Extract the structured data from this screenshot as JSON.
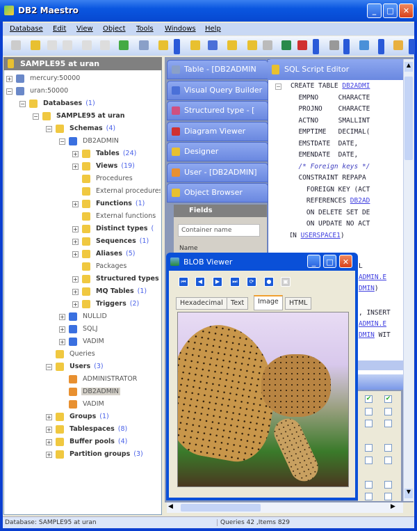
{
  "window": {
    "title": "DB2 Maestro",
    "min": "_",
    "max": "□",
    "close": "✕"
  },
  "menu": [
    "Database",
    "Edit",
    "View",
    "Object",
    "Tools",
    "Windows",
    "Help"
  ],
  "left_panel": {
    "title": "SAMPLE95 at uran"
  },
  "tree": [
    {
      "label": "mercury:50000",
      "count": "",
      "level": 0,
      "exp": "+",
      "style": "norm",
      "icon": "server-icon"
    },
    {
      "label": "uran:50000",
      "count": "",
      "level": 0,
      "exp": "−",
      "style": "norm",
      "icon": "server-icon"
    },
    {
      "label": "Databases",
      "count": "(1)",
      "level": 1,
      "exp": "−",
      "style": "bold",
      "icon": "folder-icon"
    },
    {
      "label": "SAMPLE95 at uran",
      "count": "",
      "level": 2,
      "exp": "−",
      "style": "bold",
      "icon": "database-icon"
    },
    {
      "label": "Schemas",
      "count": "(4)",
      "level": 3,
      "exp": "−",
      "style": "bold",
      "icon": "schemas-folder-icon"
    },
    {
      "label": "DB2ADMIN",
      "count": "",
      "level": 4,
      "exp": "−",
      "style": "norm",
      "icon": "schema-icon"
    },
    {
      "label": "Tables",
      "count": "(24)",
      "level": 5,
      "exp": "+",
      "style": "bold",
      "icon": "tables-folder-icon"
    },
    {
      "label": "Views",
      "count": "(19)",
      "level": 5,
      "exp": "+",
      "style": "bold",
      "icon": "views-folder-icon"
    },
    {
      "label": "Procedures",
      "count": "",
      "level": 5,
      "exp": "",
      "style": "norm",
      "icon": "procedures-folder-icon"
    },
    {
      "label": "External procedures",
      "count": "",
      "level": 5,
      "exp": "",
      "style": "norm",
      "icon": "external-procedures-folder-icon"
    },
    {
      "label": "Functions",
      "count": "(1)",
      "level": 5,
      "exp": "+",
      "style": "bold",
      "icon": "functions-folder-icon"
    },
    {
      "label": "External functions",
      "count": "",
      "level": 5,
      "exp": "",
      "style": "norm",
      "icon": "external-functions-folder-icon"
    },
    {
      "label": "Distinct types",
      "count": "(",
      "level": 5,
      "exp": "+",
      "style": "bold",
      "icon": "distinct-types-folder-icon"
    },
    {
      "label": "Sequences",
      "count": "(1)",
      "level": 5,
      "exp": "+",
      "style": "bold",
      "icon": "sequences-folder-icon"
    },
    {
      "label": "Aliases",
      "count": "(5)",
      "level": 5,
      "exp": "+",
      "style": "bold",
      "icon": "aliases-folder-icon"
    },
    {
      "label": "Packages",
      "count": "",
      "level": 5,
      "exp": "",
      "style": "norm",
      "icon": "packages-folder-icon"
    },
    {
      "label": "Structured types",
      "count": "",
      "level": 5,
      "exp": "+",
      "style": "bold",
      "icon": "structured-types-folder-icon"
    },
    {
      "label": "MQ Tables",
      "count": "(1)",
      "level": 5,
      "exp": "+",
      "style": "bold",
      "icon": "mq-tables-folder-icon"
    },
    {
      "label": "Triggers",
      "count": "(2)",
      "level": 5,
      "exp": "+",
      "style": "bold",
      "icon": "triggers-folder-icon"
    },
    {
      "label": "NULLID",
      "count": "",
      "level": 4,
      "exp": "+",
      "style": "norm",
      "icon": "schema-icon"
    },
    {
      "label": "SQLJ",
      "count": "",
      "level": 4,
      "exp": "+",
      "style": "norm",
      "icon": "schema-icon"
    },
    {
      "label": "VADIM",
      "count": "",
      "level": 4,
      "exp": "+",
      "style": "norm",
      "icon": "schema-icon"
    },
    {
      "label": "Queries",
      "count": "",
      "level": 3,
      "exp": "",
      "style": "norm",
      "icon": "queries-folder-icon"
    },
    {
      "label": "Users",
      "count": "(3)",
      "level": 3,
      "exp": "−",
      "style": "bold",
      "icon": "users-folder-icon"
    },
    {
      "label": "ADMINISTRATOR",
      "count": "",
      "level": 4,
      "exp": "",
      "style": "norm",
      "icon": "user-icon"
    },
    {
      "label": "DB2ADMIN",
      "count": "",
      "level": 4,
      "exp": "",
      "style": "norm sel",
      "icon": "user-icon"
    },
    {
      "label": "VADIM",
      "count": "",
      "level": 4,
      "exp": "",
      "style": "norm",
      "icon": "user-icon"
    },
    {
      "label": "Groups",
      "count": "(1)",
      "level": 3,
      "exp": "+",
      "style": "bold",
      "icon": "groups-folder-icon"
    },
    {
      "label": "Tablespaces",
      "count": "(8)",
      "level": 3,
      "exp": "+",
      "style": "bold",
      "icon": "tablespaces-folder-icon"
    },
    {
      "label": "Buffer pools",
      "count": "(4)",
      "level": 3,
      "exp": "+",
      "style": "bold",
      "icon": "buffer-pools-folder-icon"
    },
    {
      "label": "Partition groups",
      "count": "(3)",
      "level": 3,
      "exp": "+",
      "style": "bold",
      "icon": "partition-groups-folder-icon"
    }
  ],
  "windows": [
    "Table - [DB2ADMIN",
    "Visual Query Builder",
    "Structured type - [",
    "Diagram Viewer",
    "Designer",
    "User - [DB2ADMIN]",
    "Object Browser"
  ],
  "object_browser": {
    "fields_title": "Fields",
    "container_placeholder": "Container name",
    "name_col": "Name"
  },
  "sql_editor": {
    "title": "SQL Script Editor",
    "lines": [
      [
        "CREATE TABLE ",
        "DB2ADMI",
        ""
      ],
      [
        "  EMPNO     CHARACTE",
        "",
        ""
      ],
      [
        "  PROJNO    CHARACTE",
        "",
        ""
      ],
      [
        "  ACTNO     SMALLINT",
        "",
        ""
      ],
      [
        "  EMPTIME   DECIMAL(",
        "",
        ""
      ],
      [
        "  EMSTDATE  DATE,",
        "",
        ""
      ],
      [
        "  EMENDATE  DATE,",
        "",
        ""
      ],
      [
        "  /* Foreign keys */",
        "",
        ""
      ],
      [
        "  CONSTRAINT REPAPA",
        "",
        ""
      ],
      [
        "    FOREIGN KEY (ACT",
        "",
        ""
      ],
      [
        "    REFERENCES ",
        "DB2AD",
        ""
      ],
      [
        "    ON DELETE SET DE",
        "",
        ""
      ],
      [
        "    ON UPDATE NO ACT",
        "",
        ""
      ],
      [
        ") IN ",
        "USERSPACE1",
        ")"
      ]
    ],
    "hidden_fragments": [
      "L",
      "ADMIN.E",
      "DMIN",
      ")",
      ", INSERT",
      "ADMIN.E",
      "DMIN",
      " WIT"
    ]
  },
  "blob_viewer": {
    "title": "BLOB Viewer",
    "tabs": [
      "Hexadecimal",
      "Text",
      "Image",
      "HTML"
    ],
    "active_tab": "Image",
    "nav": [
      "⏮",
      "◀",
      "▶",
      "⏭",
      "⟳",
      "●",
      "▣"
    ]
  },
  "grid_checks": [
    [
      true,
      true
    ],
    [
      false,
      false
    ],
    [
      false,
      false
    ],
    null,
    [
      false,
      false
    ],
    [
      false,
      false
    ],
    null,
    [
      false,
      false
    ],
    [
      false,
      false
    ]
  ],
  "status": {
    "left": "Database: SAMPLE95 at uran",
    "middle": "Queries 42 ,Items 829"
  }
}
